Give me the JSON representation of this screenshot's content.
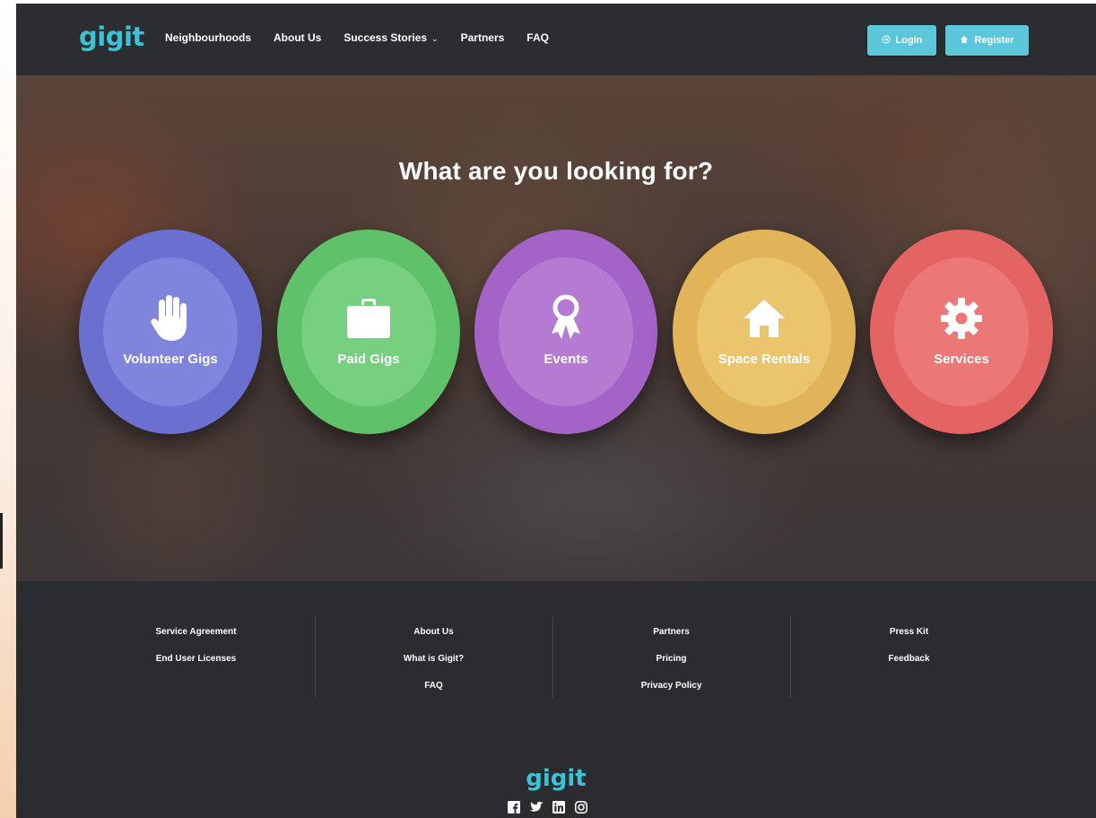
{
  "brand": {
    "logo": "gigit",
    "accent": "#3cc1d6"
  },
  "nav": {
    "links": [
      "Neighbourhoods",
      "About Us",
      "Success Stories",
      "Partners",
      "FAQ"
    ],
    "login_label": "Login",
    "register_label": "Register"
  },
  "hero": {
    "title": "What are you looking for?",
    "categories": [
      {
        "label": "Volunteer Gigs",
        "icon": "hand-icon",
        "color": "#6b6fd0"
      },
      {
        "label": "Paid Gigs",
        "icon": "briefcase-icon",
        "color": "#5fc26a"
      },
      {
        "label": "Events",
        "icon": "award-ribbon-icon",
        "color": "#a463c6"
      },
      {
        "label": "Space Rentals",
        "icon": "home-icon",
        "color": "#e2b45a"
      },
      {
        "label": "Services",
        "icon": "gear-icon",
        "color": "#e46464"
      }
    ]
  },
  "footer": {
    "columns": [
      [
        "Service Agreement",
        "End User Licenses"
      ],
      [
        "About Us",
        "What is Gigit?",
        "FAQ"
      ],
      [
        "Partners",
        "Pricing",
        "Privacy Policy"
      ],
      [
        "Press Kit",
        "Feedback"
      ]
    ],
    "logo": "gigit",
    "social": [
      "facebook-icon",
      "twitter-icon",
      "linkedin-icon",
      "instagram-icon"
    ]
  }
}
